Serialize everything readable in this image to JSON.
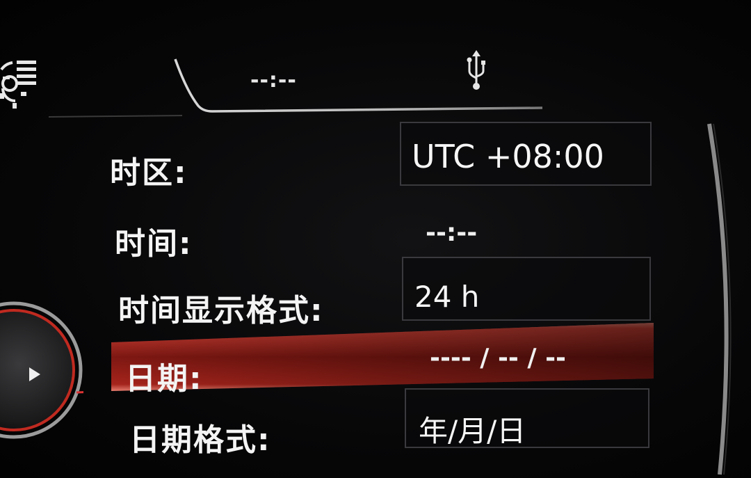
{
  "status_bar": {
    "clock": "--:--",
    "usb_icon": "usb-icon",
    "settings_icon": "settings-gear-list-icon"
  },
  "settings": {
    "timezone": {
      "label": "时区:",
      "value": "UTC +08:00"
    },
    "time": {
      "label": "时间:",
      "value": "--:--"
    },
    "time_format": {
      "label": "时间显示格式:",
      "value": "24 h"
    },
    "date": {
      "label": "日期:",
      "value": "---- / -- / --"
    },
    "date_format": {
      "label": "日期格式:",
      "value": "年/月/日"
    }
  },
  "colors": {
    "highlight": "#c0281e",
    "frame_line": "#c8c8c8",
    "text": "#f4f4f4"
  }
}
